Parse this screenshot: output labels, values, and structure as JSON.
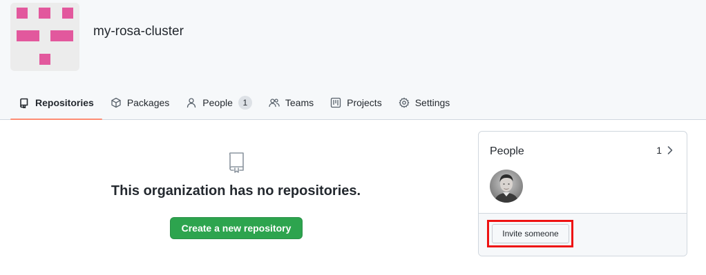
{
  "org": {
    "name": "my-rosa-cluster"
  },
  "colors": {
    "accent_underline": "#fd8c73",
    "identicon": "#e2589d",
    "primary_button": "#2da44e",
    "highlight": "#ee1111"
  },
  "tabs": [
    {
      "label": "Repositories",
      "icon": "repo-icon",
      "selected": true
    },
    {
      "label": "Packages",
      "icon": "package-icon"
    },
    {
      "label": "People",
      "icon": "person-icon",
      "counter": "1"
    },
    {
      "label": "Teams",
      "icon": "people-icon"
    },
    {
      "label": "Projects",
      "icon": "project-icon"
    },
    {
      "label": "Settings",
      "icon": "gear-icon"
    }
  ],
  "main": {
    "empty_icon": "repo-icon",
    "empty_message": "This organization has no repositories.",
    "create_button": "Create a new repository"
  },
  "people_panel": {
    "title": "People",
    "count": "1",
    "chevron_icon": "chevron-right-icon",
    "invite_button": "Invite someone"
  }
}
